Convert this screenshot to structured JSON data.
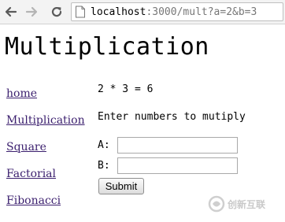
{
  "browser": {
    "url_host": "localhost",
    "url_rest": ":3000/mult?a=2&b=3",
    "icons": [
      "back-arrow-icon",
      "forward-arrow-icon",
      "reload-icon",
      "page-icon"
    ]
  },
  "page": {
    "title": "Multiplication",
    "nav_links": [
      {
        "label": "home"
      },
      {
        "label": "Multiplication"
      },
      {
        "label": "Square"
      },
      {
        "label": "Factorial"
      },
      {
        "label": "Fibonacci"
      }
    ],
    "result": "2 * 3 = 6",
    "prompt": "Enter numbers to mutiply",
    "form": {
      "label_a": "A:",
      "value_a": "",
      "label_b": "B:",
      "value_b": "",
      "submit_label": "Submit"
    }
  },
  "watermark": {
    "text": "创新互联",
    "logo_icon": "swirl-logo-icon"
  }
}
